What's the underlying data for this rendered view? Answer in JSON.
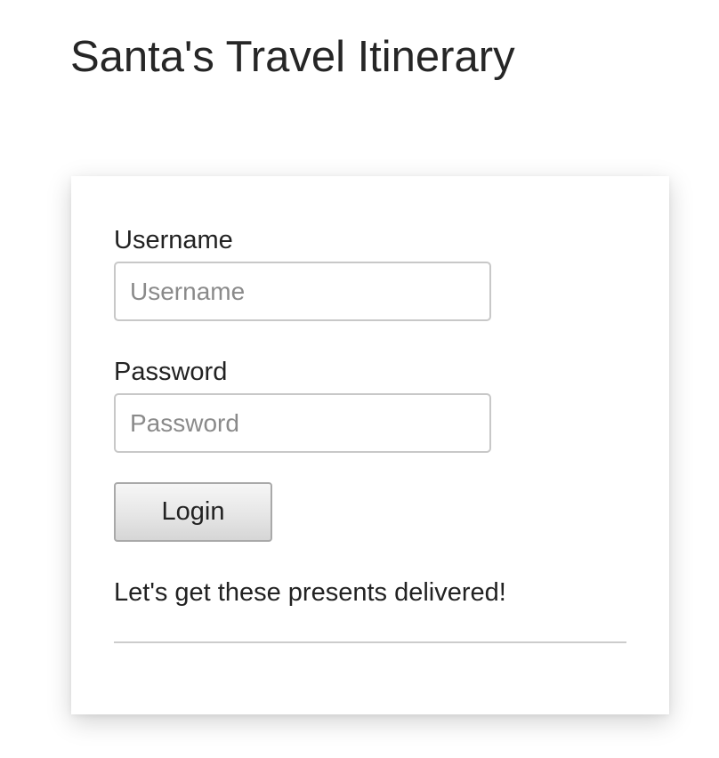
{
  "page": {
    "title": "Santa's Travel Itinerary"
  },
  "login_form": {
    "username_label": "Username",
    "username_placeholder": "Username",
    "username_value": "",
    "password_label": "Password",
    "password_placeholder": "Password",
    "password_value": "",
    "login_button_label": "Login",
    "tagline": "Let's get these presents delivered!"
  },
  "colors": {
    "background": "#ffffff",
    "text": "#222222",
    "input_border": "#c8c8c8",
    "button_border": "#a9a9a9",
    "divider": "#cccccc"
  }
}
